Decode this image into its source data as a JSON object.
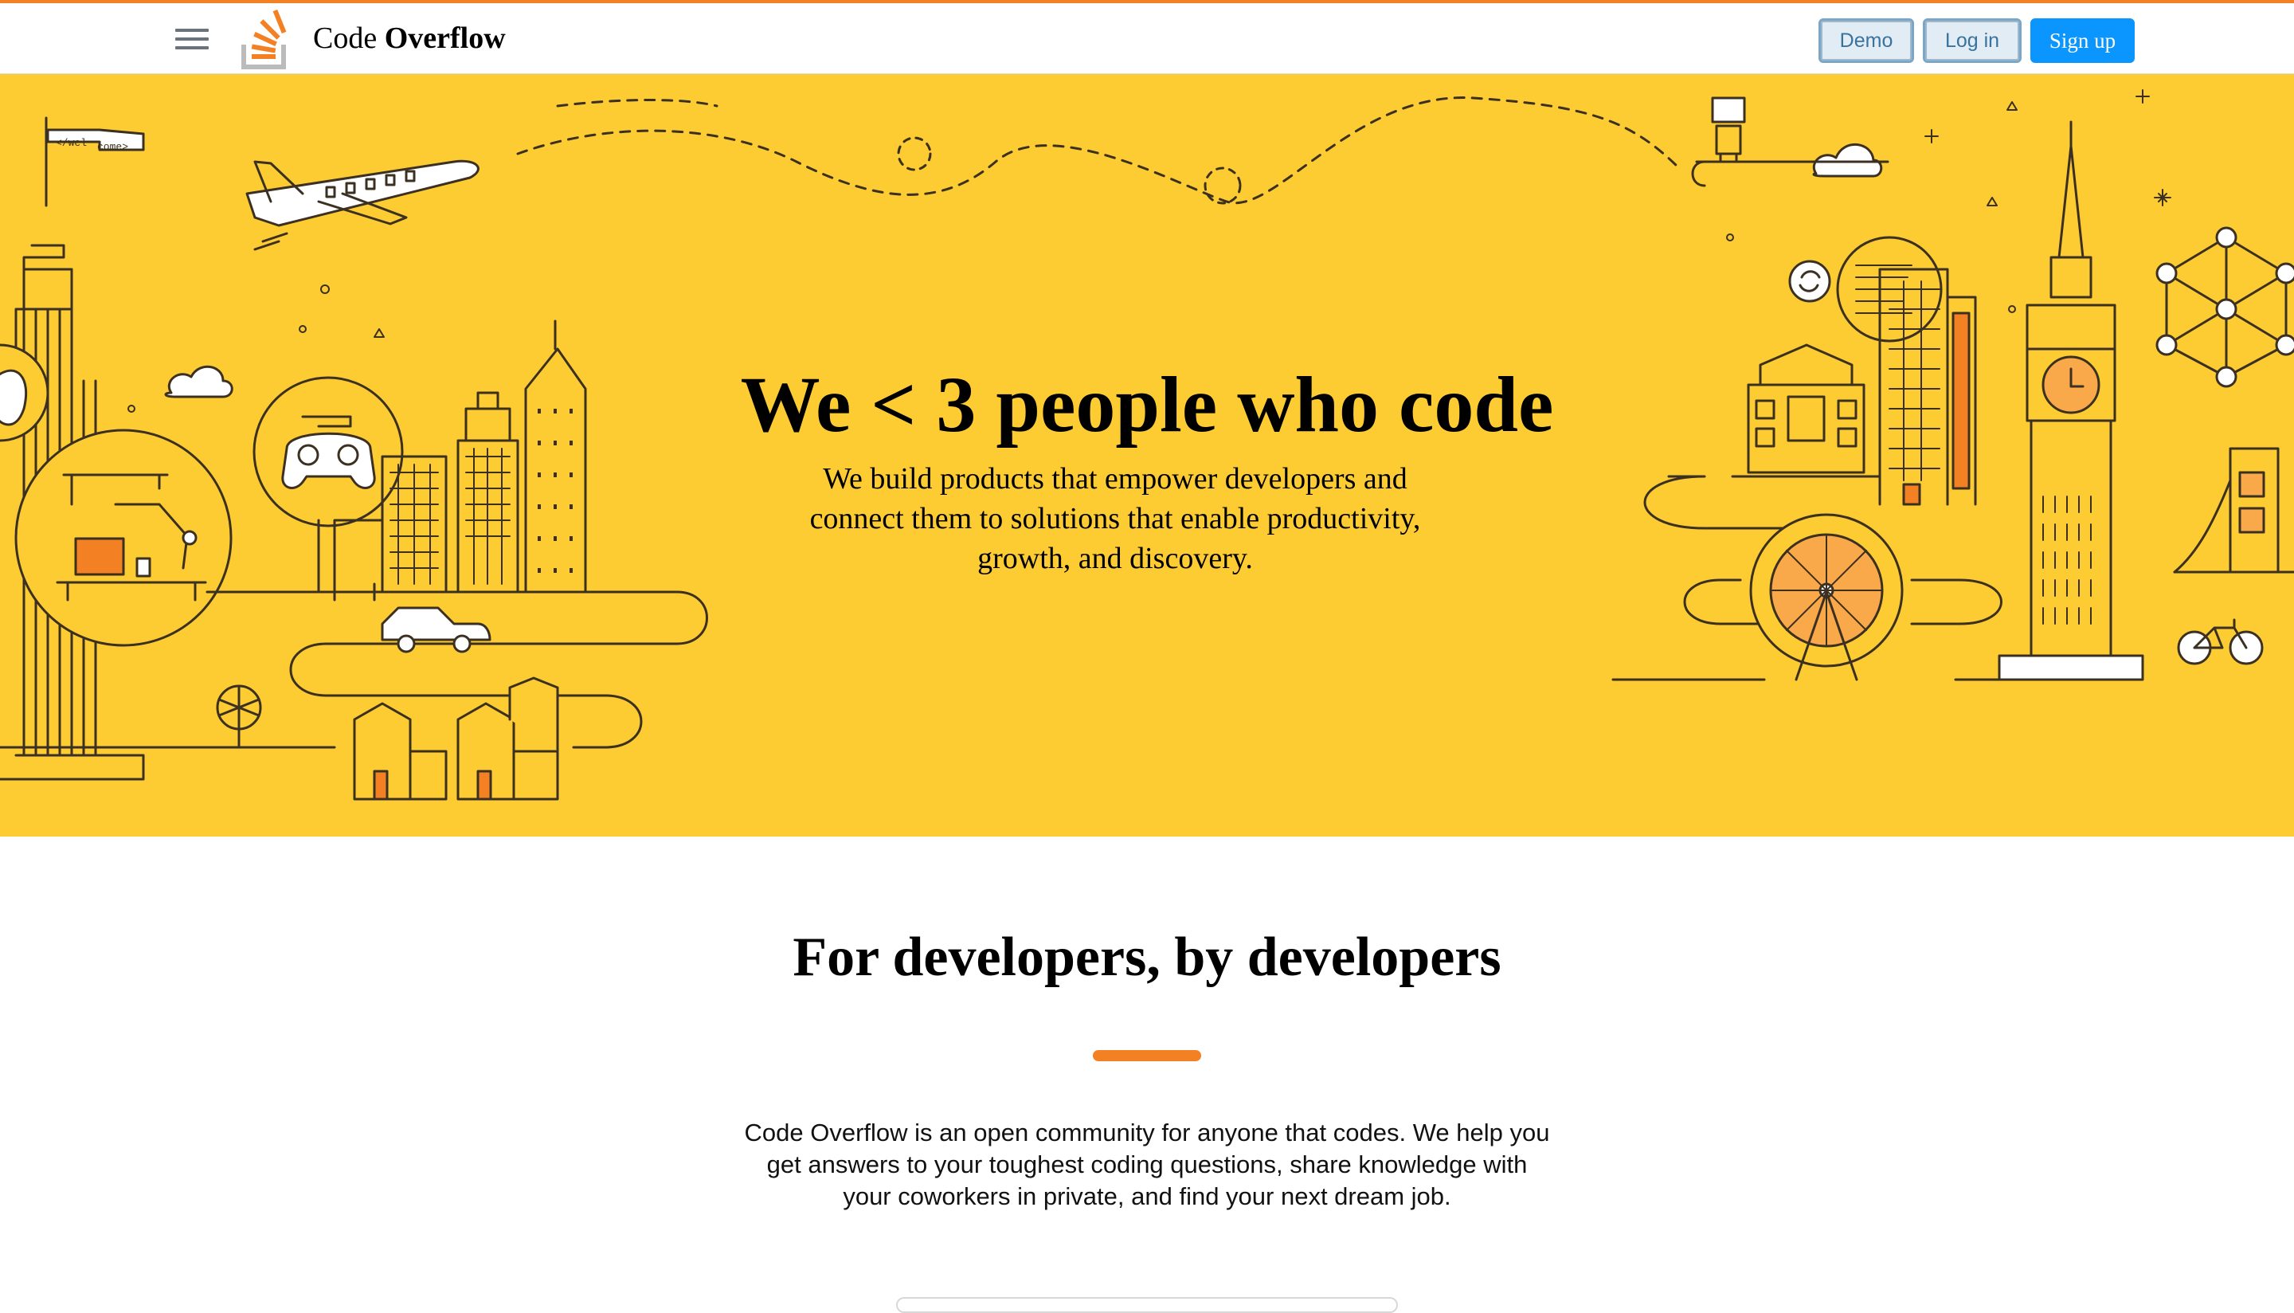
{
  "header": {
    "menu_icon": "hamburger-menu-icon",
    "logo_icon": "stack-logo-icon",
    "brand_regular": "Code ",
    "brand_bold": "Overflow",
    "demo_label": "Demo",
    "login_label": "Log in",
    "signup_label": "Sign up"
  },
  "hero": {
    "title": "We < 3 people who code",
    "subtitle": "We build products that empower developers and connect them to solutions that enable productivity, growth, and discovery.",
    "flag_text_1": "</wel",
    "flag_text_2": "come>"
  },
  "about": {
    "title": "For developers, by developers",
    "body": "Code Overflow is an open community for anyone that codes. We help you get answers to your toughest coding questions, share knowledge with your coworkers in private, and find your next dream job."
  },
  "colors": {
    "accent": "#f48024",
    "hero_bg": "#fdcc33",
    "primary_button": "#0a95ff",
    "secondary_button": "#e1ecf4"
  }
}
